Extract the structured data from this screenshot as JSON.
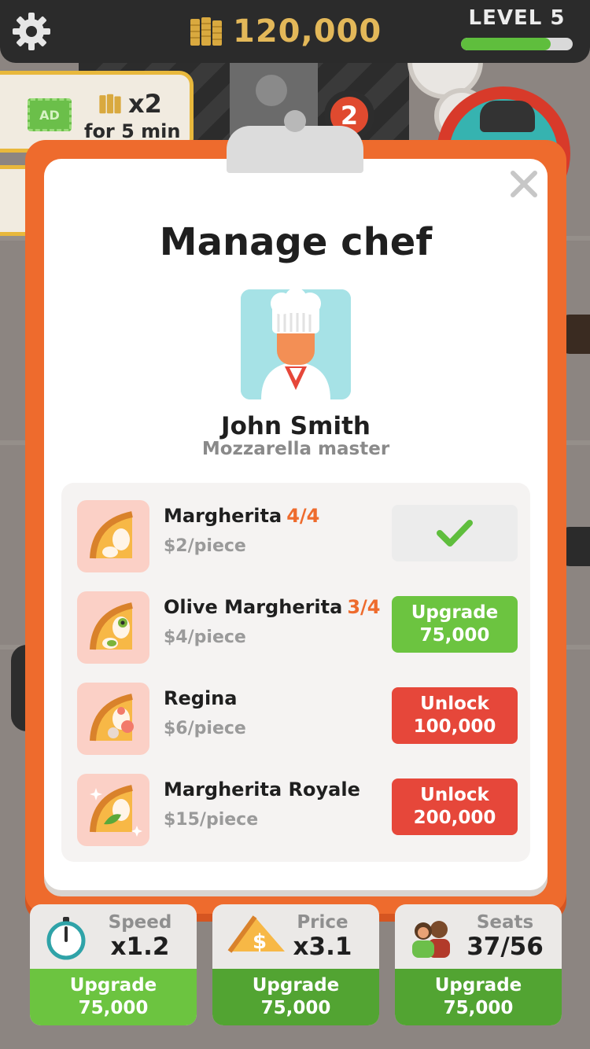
{
  "topbar": {
    "coins": "120,000",
    "level_label": "LEVEL 5",
    "level_progress": 0.8,
    "icons": {
      "settings": "gear-icon",
      "coins": "coin-stack-icon"
    }
  },
  "ad_boost": {
    "ad_label": "AD",
    "multiplier": "x2",
    "duration": "for 5 min"
  },
  "background": {
    "badge_number": "2"
  },
  "modal": {
    "title": "Manage chef",
    "chef": {
      "name": "John Smith",
      "role": "Mozzarella master"
    },
    "recipes": [
      {
        "name": "Margherita",
        "count": "4/4",
        "price": "$2/piece",
        "action_state": "completed",
        "icon": "pizza-slice-icon"
      },
      {
        "name": "Olive Margherita",
        "count": "3/4",
        "price": "$4/piece",
        "action_line1": "Upgrade",
        "action_line2": "75,000",
        "action_state": "upgrade",
        "icon": "pizza-slice-icon"
      },
      {
        "name": "Regina",
        "count": "",
        "price": "$6/piece",
        "action_line1": "Unlock",
        "action_line2": "100,000",
        "action_state": "unlock",
        "icon": "pizza-slice-icon"
      },
      {
        "name": "Margherita Royale",
        "count": "",
        "price": "$15/piece",
        "action_line1": "Unlock",
        "action_line2": "200,000",
        "action_state": "unlock",
        "icon": "pizza-slice-icon"
      }
    ]
  },
  "stats": [
    {
      "label": "Speed",
      "value": "x1.2",
      "upgrade_label": "Upgrade",
      "upgrade_cost": "75,000",
      "icon": "stopwatch-icon"
    },
    {
      "label": "Price",
      "value": "x3.1",
      "upgrade_label": "Upgrade",
      "upgrade_cost": "75,000",
      "icon": "pizza-dollar-icon"
    },
    {
      "label": "Seats",
      "value": "37/56",
      "upgrade_label": "Upgrade",
      "upgrade_cost": "75,000",
      "icon": "customers-icon"
    }
  ],
  "colors": {
    "accent_orange": "#ee6b2d",
    "upgrade_green": "#6cc440",
    "unlock_red": "#e6473a",
    "coin_gold": "#e3b859"
  }
}
